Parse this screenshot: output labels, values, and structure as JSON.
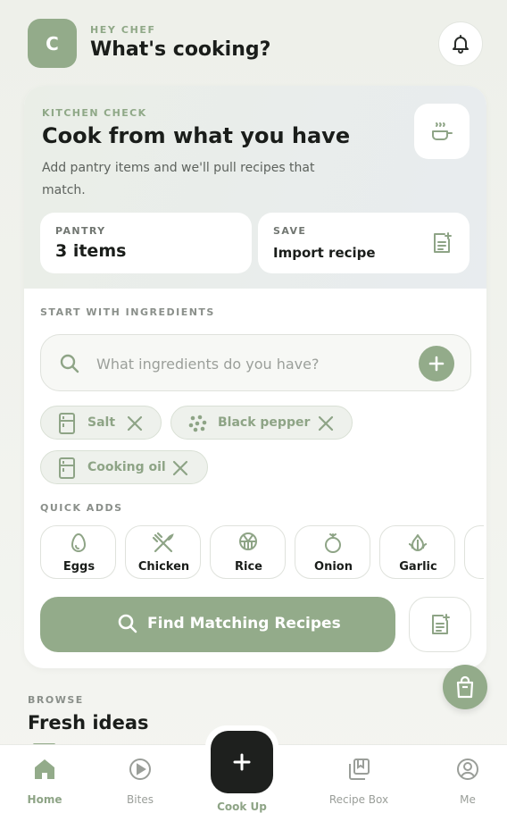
{
  "header": {
    "avatar_initial": "C",
    "greeting": "HEY CHEF",
    "title": "What's cooking?"
  },
  "kitchen_check": {
    "label": "KITCHEN CHECK",
    "title": "Cook from what you have",
    "description": "Add pantry items and we'll pull recipes that match.",
    "pantry_label": "PANTRY",
    "pantry_value": "3 items",
    "save_label": "SAVE",
    "save_value": "Import recipe"
  },
  "ingredients": {
    "section_label": "START WITH INGREDIENTS",
    "search_placeholder": "What ingredients do you have?",
    "chips": [
      {
        "label": "Salt",
        "icon": "fridge-icon"
      },
      {
        "label": "Black pepper",
        "icon": "dots-icon"
      },
      {
        "label": "Cooking oil",
        "icon": "fridge-icon"
      }
    ]
  },
  "quick_adds": {
    "section_label": "QUICK ADDS",
    "items": [
      {
        "label": "Eggs",
        "icon": "egg-icon"
      },
      {
        "label": "Chicken",
        "icon": "utensils-icon"
      },
      {
        "label": "Rice",
        "icon": "rice-bowl-icon"
      },
      {
        "label": "Onion",
        "icon": "onion-icon"
      },
      {
        "label": "Garlic",
        "icon": "garlic-icon"
      }
    ]
  },
  "actions": {
    "find_label": "Find Matching Recipes"
  },
  "browse": {
    "label": "BROWSE",
    "title": "Fresh ideas"
  },
  "nav": {
    "home": "Home",
    "bites": "Bites",
    "cook_up": "Cook Up",
    "recipe_box": "Recipe Box",
    "me": "Me"
  },
  "colors": {
    "accent": "#93ab8a",
    "dark": "#1e201e",
    "text": "#1a1d1a"
  }
}
